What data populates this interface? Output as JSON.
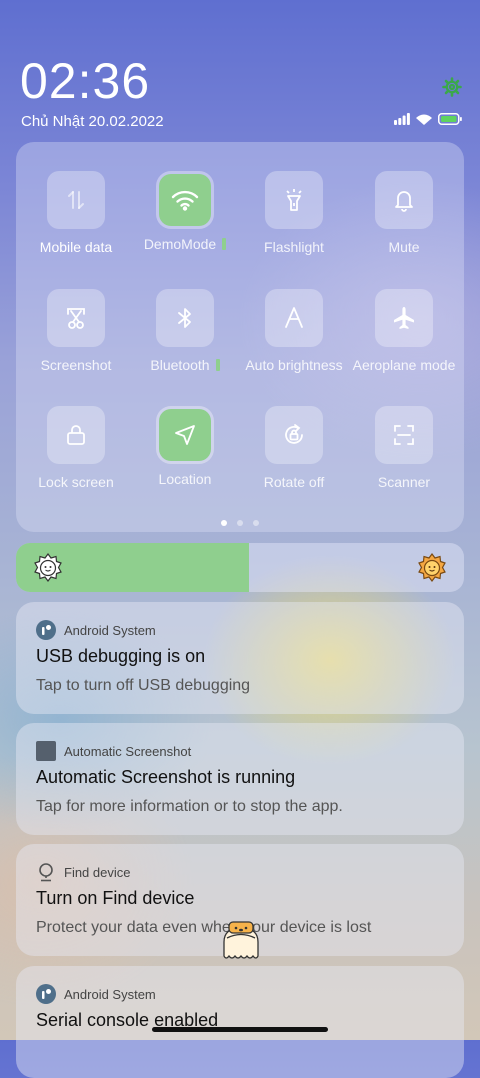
{
  "status_bar": {
    "time": "02:36",
    "date": "Chủ Nhật 20.02.2022",
    "icons": [
      "signal-icon",
      "wifi-icon",
      "battery-icon"
    ],
    "settings_icon": "gear-icon"
  },
  "quick_settings": {
    "tiles": [
      {
        "label": "Mobile data",
        "icon": "mobile-data-icon",
        "active": false
      },
      {
        "label": "DemoMode",
        "icon": "wifi-icon",
        "active": true
      },
      {
        "label": "Flashlight",
        "icon": "flashlight-icon",
        "active": false
      },
      {
        "label": "Mute",
        "icon": "bell-icon",
        "active": false
      },
      {
        "label": "Screenshot",
        "icon": "scissors-icon",
        "active": false
      },
      {
        "label": "Bluetooth",
        "icon": "bluetooth-icon",
        "active": false
      },
      {
        "label": "Auto brightness",
        "icon": "auto-brightness-icon",
        "active": false
      },
      {
        "label": "Aeroplane mode",
        "icon": "airplane-icon",
        "active": false
      },
      {
        "label": "Lock screen",
        "icon": "lock-icon",
        "active": false
      },
      {
        "label": "Location",
        "icon": "location-arrow-icon",
        "active": true
      },
      {
        "label": "Rotate off",
        "icon": "rotate-lock-icon",
        "active": false
      },
      {
        "label": "Scanner",
        "icon": "scanner-icon",
        "active": false
      }
    ],
    "page_count": 3,
    "current_page": 1
  },
  "brightness": {
    "level": 0.52,
    "accent": "#8fcf8e"
  },
  "notifications": [
    {
      "app": "Android System",
      "title": "USB debugging is on",
      "body": "Tap to turn off USB debugging",
      "icon": "android-system-icon"
    },
    {
      "app": "Automatic Screenshot",
      "title": "Automatic Screenshot is running",
      "body": "Tap for more information or to stop the app.",
      "icon": "app-square-icon"
    },
    {
      "app": "Find device",
      "title": "Turn on Find device",
      "body": "Protect your data even when your device is lost",
      "icon": "location-pin-icon"
    },
    {
      "app": "Android System",
      "title": "Serial console enabled",
      "body": "",
      "icon": "android-system-icon"
    }
  ]
}
